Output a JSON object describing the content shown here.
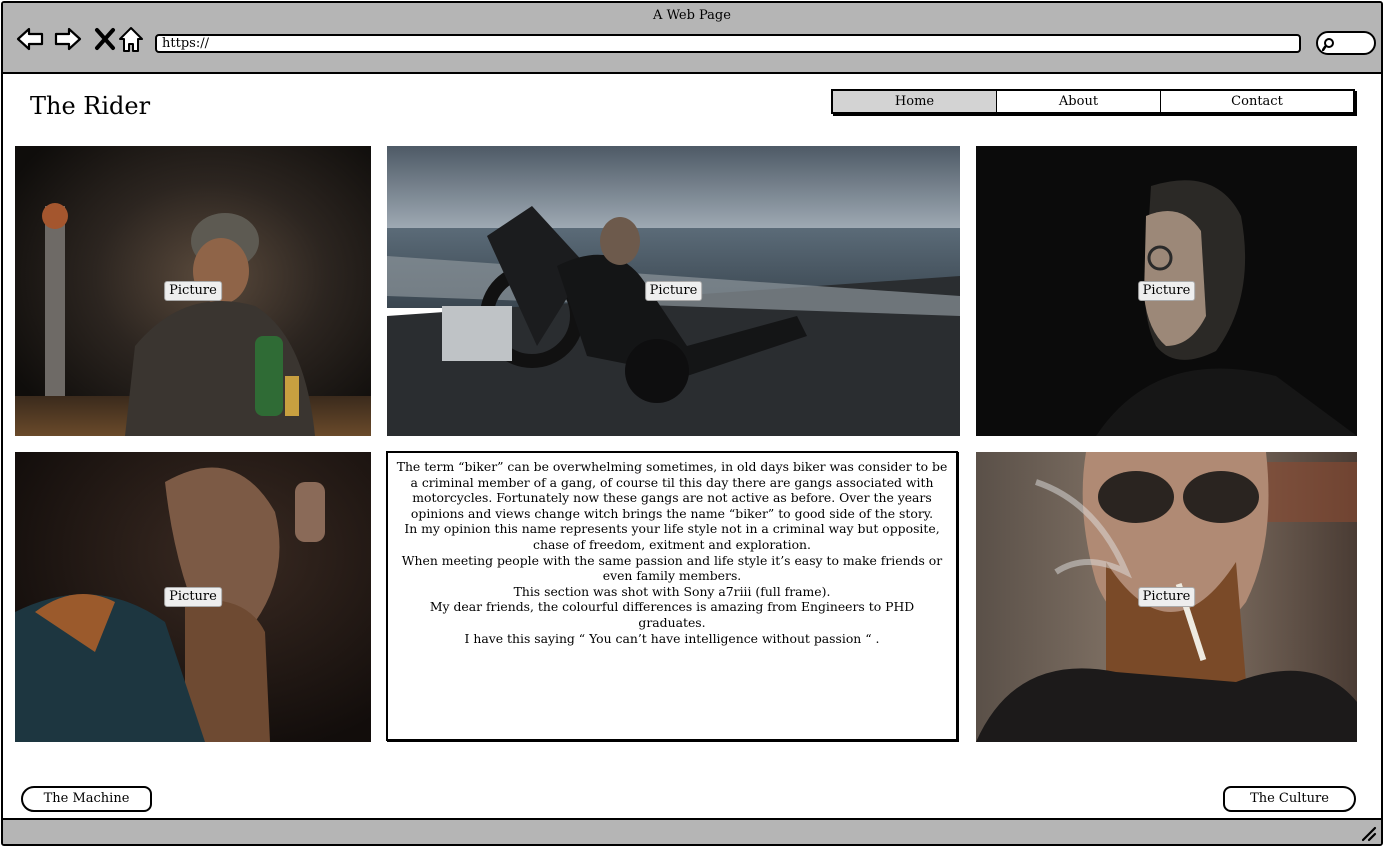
{
  "browser": {
    "title": "A Web Page",
    "url": "https://"
  },
  "site": {
    "title": "The Rider"
  },
  "menu": {
    "items": [
      {
        "label": "Home",
        "active": true
      },
      {
        "label": "About",
        "active": false
      },
      {
        "label": "Contact",
        "active": false
      }
    ]
  },
  "pictures": {
    "label": "Picture"
  },
  "article": {
    "paragraphs": [
      "The term “biker” can be overwhelming sometimes, in old days biker was consider to be a criminal member of a gang, of course til this day there are gangs associated with motorcycles. Fortunately now these gangs are not active as before. Over the years opinions and views change witch brings the name “biker” to good side of the story.",
      "In my opinion this name represents your life style not in a criminal way but opposite, chase of freedom, exitment and exploration.",
      "When meeting people with the same passion and life style it’s easy to make friends or even family members.",
      "This section was shot with Sony a7riii (full frame).",
      "My dear friends, the colourful differences is amazing from Engineers to PHD graduates.",
      "I have this saying “ You can’t have intelligence without passion “ ."
    ]
  },
  "pager": {
    "prev_label": "The Machine",
    "next_label": "The Culture"
  }
}
